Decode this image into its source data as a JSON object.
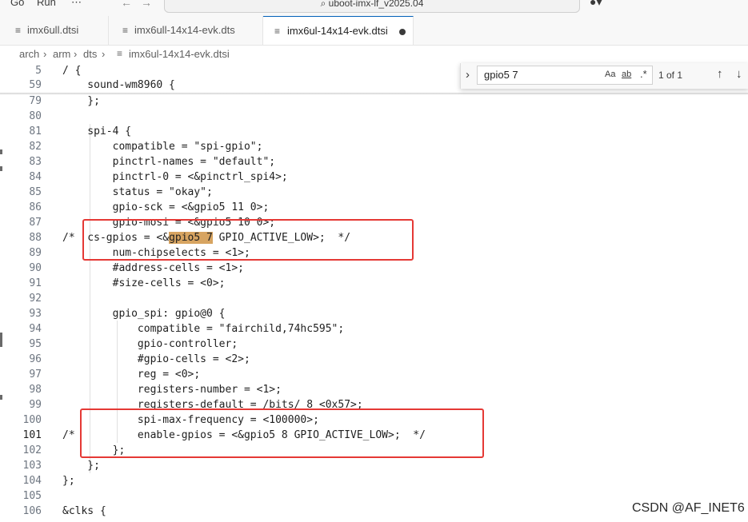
{
  "titlebar": {
    "menu": [
      "Go",
      "Run",
      "⋯"
    ],
    "search_text": "⌕ uboot-imx-lf_v2025.04",
    "back_icon": "arrow-left-icon",
    "forward_icon": "arrow-right-icon"
  },
  "tabs": [
    {
      "label": "imx6ull.dtsi",
      "icon": "≡",
      "active": false
    },
    {
      "label": "imx6ull-14x14-evk.dts",
      "icon": "≡",
      "active": false
    },
    {
      "label": "imx6ul-14x14-evk.dtsi",
      "icon": "≡",
      "active": true,
      "modified": true
    }
  ],
  "breadcrumb": {
    "parts": [
      "arch",
      "arm",
      "dts"
    ],
    "file": "imx6ul-14x14-evk.dtsi",
    "separator": "›"
  },
  "find": {
    "toggle": "›",
    "value": "gpio5 7",
    "opt_case": "Aa",
    "opt_word": "ab",
    "opt_regex": ".*",
    "count": "1 of 1",
    "prev": "↑",
    "next": "↓"
  },
  "sticky": [
    {
      "n": "5",
      "text": "/ {"
    },
    {
      "n": "59",
      "text": "    sound-wm8960 {"
    }
  ],
  "lines": [
    {
      "n": "79",
      "text": "    };"
    },
    {
      "n": "80",
      "text": ""
    },
    {
      "n": "81",
      "text": "    spi-4 {"
    },
    {
      "n": "82",
      "text": "        compatible = \"spi-gpio\";"
    },
    {
      "n": "83",
      "text": "        pinctrl-names = \"default\";"
    },
    {
      "n": "84",
      "text": "        pinctrl-0 = <&pinctrl_spi4>;"
    },
    {
      "n": "85",
      "text": "        status = \"okay\";"
    },
    {
      "n": "86",
      "text": "        gpio-sck = <&gpio5 11 0>;"
    },
    {
      "n": "87",
      "text": "        gpio-mosi = <&gpio5 10 0>;"
    },
    {
      "n": "88",
      "pre": "/*  cs-gpios = <&",
      "match": "gpio5 7",
      "post": " GPIO_ACTIVE_LOW>;  */"
    },
    {
      "n": "89",
      "text": "        num-chipselects = <1>;"
    },
    {
      "n": "90",
      "text": "        #address-cells = <1>;"
    },
    {
      "n": "91",
      "text": "        #size-cells = <0>;"
    },
    {
      "n": "92",
      "text": ""
    },
    {
      "n": "93",
      "text": "        gpio_spi: gpio@0 {"
    },
    {
      "n": "94",
      "text": "            compatible = \"fairchild,74hc595\";"
    },
    {
      "n": "95",
      "text": "            gpio-controller;"
    },
    {
      "n": "96",
      "text": "            #gpio-cells = <2>;"
    },
    {
      "n": "97",
      "text": "            reg = <0>;"
    },
    {
      "n": "98",
      "text": "            registers-number = <1>;"
    },
    {
      "n": "99",
      "text": "            registers-default = /bits/ 8 <0x57>;"
    },
    {
      "n": "100",
      "text": "            spi-max-frequency = <100000>;"
    },
    {
      "n": "101",
      "text": "/*          enable-gpios = <&gpio5 8 GPIO_ACTIVE_LOW>;  */",
      "current": true
    },
    {
      "n": "102",
      "text": "        };"
    },
    {
      "n": "103",
      "text": "    };"
    },
    {
      "n": "104",
      "text": "};"
    },
    {
      "n": "105",
      "text": ""
    },
    {
      "n": "106",
      "text": "&clks {"
    }
  ],
  "watermark": "CSDN @AF_INET6",
  "colors": {
    "find_match": "#d7a461",
    "annotation_box": "#e53935",
    "active_tab_border": "#005fb8"
  }
}
